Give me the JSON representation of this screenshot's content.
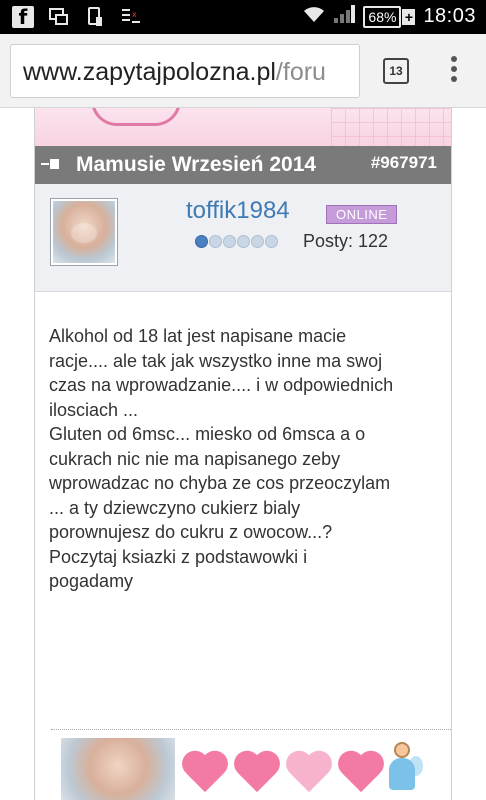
{
  "status_bar": {
    "left_icons": [
      "facebook-icon",
      "screen-mirror-icon",
      "phone-storage-icon",
      "signal-settings-icon"
    ],
    "battery": "68%",
    "time": "18:03"
  },
  "browser": {
    "url_domain": "www.zapytajpolozna.pl",
    "url_path": "/foru",
    "tab_count": "13"
  },
  "topic": {
    "title": "Mamusie Wrzesień 2014",
    "post_number": "#967971"
  },
  "user": {
    "name": "toffik1984",
    "status": "ONLINE",
    "rank_level": 1,
    "rank_max": 6,
    "posts_label": "Posty: 122"
  },
  "post": {
    "lines": [
      "Alkohol od 18 lat jest napisane macie",
      "racje.... ale tak jak wszystko inne ma swoj",
      "czas na wprowadzanie.... i w odpowiednich",
      "ilosciach ...",
      "Gluten od 6msc... miesko od 6msca a o",
      "cukrach nic nie ma napisanego zeby",
      "wprowadzac no chyba ze cos przeoczylam",
      "... a ty dziewczyno cukierz bialy",
      "porownujesz do cukru z owocow...?",
      "Poczytaj ksiazki z podstawowki i",
      "pogadamy"
    ]
  },
  "colors": {
    "title_bar": "#7a7a7a",
    "username": "#3f7ab2",
    "online_badge": "#c59bd9",
    "heart": "#f47aa6"
  }
}
